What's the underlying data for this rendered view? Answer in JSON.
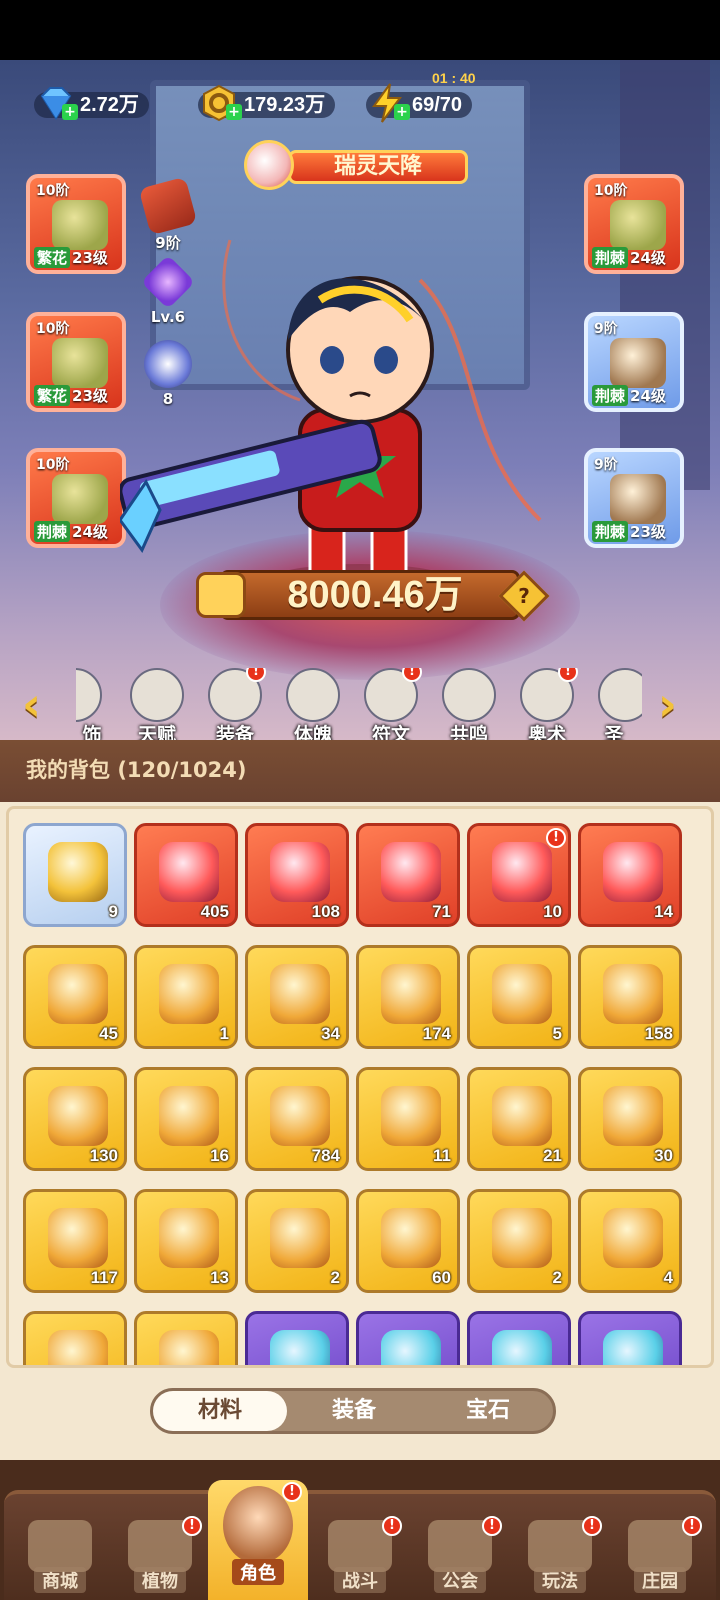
{
  "resources": {
    "diamond": "2.72万",
    "gold": "179.23万",
    "energy": "69/70",
    "energy_timer": "01 : 40"
  },
  "event_banner": "瑞灵天降",
  "left_equip": [
    {
      "grade": "10阶",
      "set": "繁花",
      "level": "23级"
    },
    {
      "grade": "10阶",
      "set": "繁花",
      "level": "23级"
    },
    {
      "grade": "10阶",
      "set": "荆棘",
      "level": "24级"
    }
  ],
  "right_equip": [
    {
      "grade": "10阶",
      "set": "荆棘",
      "level": "24级"
    },
    {
      "grade": "9阶",
      "set": "荆棘",
      "level": "24级"
    },
    {
      "grade": "9阶",
      "set": "荆棘",
      "level": "23级"
    }
  ],
  "mini_stats": [
    {
      "icon": "relic-icon",
      "label": "9阶"
    },
    {
      "icon": "crystal-icon",
      "label": "Lv.6"
    },
    {
      "icon": "orb-icon",
      "label": "8"
    }
  ],
  "power": {
    "value": "8000.46万",
    "help": "?"
  },
  "tabs": [
    {
      "label": "饰",
      "badge": ""
    },
    {
      "label": "天赋",
      "badge": ""
    },
    {
      "label": "装备",
      "badge": "!"
    },
    {
      "label": "体魄",
      "badge": ""
    },
    {
      "label": "符文",
      "badge": "!"
    },
    {
      "label": "共鸣",
      "badge": ""
    },
    {
      "label": "奥术",
      "badge": "!"
    },
    {
      "label": "圣",
      "badge": ""
    }
  ],
  "bag": {
    "title": "我的背包",
    "capacity": "(120/1024)",
    "rows": [
      [
        {
          "icon": "star-icon",
          "count": "9",
          "rarity": "blue"
        },
        {
          "icon": "ice-star-icon",
          "count": "405",
          "rarity": "red"
        },
        {
          "icon": "red-potion-icon",
          "count": "108",
          "rarity": "red"
        },
        {
          "icon": "green-vial-icon",
          "count": "71",
          "rarity": "red"
        },
        {
          "icon": "green-crystal-icon",
          "count": "10",
          "rarity": "red",
          "badge": "!"
        },
        {
          "icon": "flower-bundle-icon",
          "count": "14",
          "rarity": "red"
        }
      ],
      [
        {
          "icon": "flask-icon",
          "count": "45",
          "rarity": "gold"
        },
        {
          "icon": "water-drop-icon",
          "count": "1",
          "rarity": "gold"
        },
        {
          "icon": "skull-scroll-icon",
          "count": "34",
          "rarity": "gold"
        },
        {
          "icon": "key-icon",
          "count": "174",
          "rarity": "gold"
        },
        {
          "icon": "flame-leaf-icon",
          "count": "5",
          "rarity": "gold"
        },
        {
          "icon": "prism-icon",
          "count": "158",
          "rarity": "gold"
        }
      ],
      [
        {
          "icon": "golden-bloom-icon",
          "count": "130",
          "rarity": "gold"
        },
        {
          "icon": "rune-stone-icon",
          "count": "16",
          "rarity": "gold"
        },
        {
          "icon": "orange-potion-icon",
          "count": "784",
          "rarity": "gold"
        },
        {
          "icon": "gold-ore-icon",
          "count": "11",
          "rarity": "gold"
        },
        {
          "icon": "red-bloom-icon",
          "count": "21",
          "rarity": "gold"
        },
        {
          "icon": "flower-pot-icon",
          "count": "30",
          "rarity": "gold"
        }
      ],
      [
        {
          "icon": "sprayer-icon",
          "count": "117",
          "rarity": "gold"
        },
        {
          "icon": "spell-book-icon",
          "count": "13",
          "rarity": "gold"
        },
        {
          "icon": "can-icon",
          "count": "2",
          "rarity": "gold"
        },
        {
          "icon": "owl-icon",
          "count": "60",
          "rarity": "gold"
        },
        {
          "icon": "amber-gem-icon",
          "count": "2",
          "rarity": "gold"
        },
        {
          "icon": "lantern-flower-icon",
          "count": "4",
          "rarity": "gold"
        }
      ],
      [
        {
          "icon": "knot-icon",
          "count": "",
          "rarity": "gold"
        },
        {
          "icon": "fire-icon",
          "count": "",
          "rarity": "gold"
        },
        {
          "icon": "purple-potion-icon",
          "count": "",
          "rarity": "purple"
        },
        {
          "icon": "emblem-icon",
          "count": "",
          "rarity": "purple"
        },
        {
          "icon": "leaf-icon",
          "count": "",
          "rarity": "purple"
        },
        {
          "icon": "scroll-bundle-icon",
          "count": "",
          "rarity": "purple"
        }
      ]
    ]
  },
  "bag_tabs": [
    {
      "label": "材料",
      "active": true
    },
    {
      "label": "装备",
      "active": false
    },
    {
      "label": "宝石",
      "active": false
    }
  ],
  "nav": [
    {
      "label": "商城",
      "badge": "",
      "active": false
    },
    {
      "label": "植物",
      "badge": "!",
      "active": false
    },
    {
      "label": "角色",
      "badge": "!",
      "active": true
    },
    {
      "label": "战斗",
      "badge": "!",
      "active": false
    },
    {
      "label": "公会",
      "badge": "!",
      "active": false
    },
    {
      "label": "玩法",
      "badge": "!",
      "active": false
    },
    {
      "label": "庄园",
      "badge": "!",
      "active": false
    }
  ]
}
